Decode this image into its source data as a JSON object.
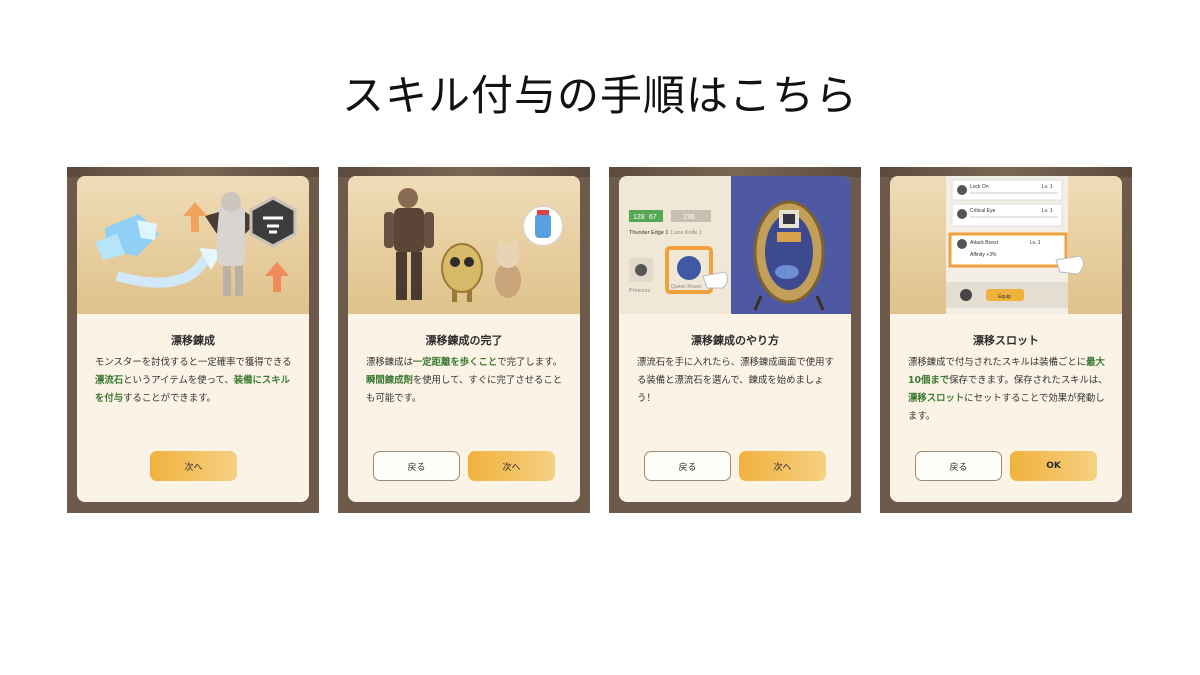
{
  "page_title": "スキル付与の手順はこちら",
  "cards": [
    {
      "title": "漂移錬成",
      "body": [
        {
          "text": "モンスターを討伐すると一定確率で獲得で"
        },
        {
          "text": "きる"
        },
        {
          "text": "漂流石",
          "hl": true
        },
        {
          "text": "というアイテムを使って、"
        },
        {
          "text": "装備",
          "hl": true
        },
        {
          "text": "にスキルを付与",
          "hl": true
        },
        {
          "text": "することができます。"
        }
      ],
      "buttons": {
        "next": "次へ"
      }
    },
    {
      "title": "漂移錬成の完了",
      "body": [
        {
          "text": "漂移錬成は"
        },
        {
          "text": "一定距離を歩くこと",
          "hl": true
        },
        {
          "text": "で完了しま"
        },
        {
          "text": "す。"
        },
        {
          "text": "瞬間錬成剤",
          "hl": true
        },
        {
          "text": "を使用して、すぐに完了さ"
        },
        {
          "text": "せることも可能です。"
        }
      ],
      "buttons": {
        "back": "戻る",
        "next": "次へ"
      }
    },
    {
      "title": "漂移錬成のやり方",
      "body": [
        {
          "text": "漂流石を手に入れたら、漂移錬成画面で使"
        },
        {
          "text": "用する装備と漂流石を選んで、錬成を始め"
        },
        {
          "text": "ましょう！"
        }
      ],
      "buttons": {
        "back": "戻る",
        "next": "次へ"
      },
      "screen_labels": {
        "stat_a": "128",
        "stat_b": "67",
        "stat_c": "236",
        "item_a": "Thunder Edge 1",
        "item_b": "Luna Knife 1",
        "item_c": "Princess",
        "item_d": "Queen Roses"
      }
    },
    {
      "title": "漂移スロット",
      "body": [
        {
          "text": "漂移錬成で付与されたスキルは装備ごとに"
        },
        {
          "text": "最大10個まで",
          "hl": true
        },
        {
          "text": "保存できます。保存された"
        },
        {
          "text": "スキルは、"
        },
        {
          "text": "漂移スロット",
          "hl": true
        },
        {
          "text": "にセットすること"
        },
        {
          "text": "で効果が発動します。"
        }
      ],
      "buttons": {
        "back": "戻る",
        "ok": "OK"
      },
      "screen_labels": {
        "skill_1": "Lock On",
        "skill_2": "Critical Eye",
        "skill_3": "Attack Boost",
        "level": "Lv. 1",
        "sub": "Affinity +3%",
        "save": "Equip"
      }
    }
  ],
  "colors": {
    "accent": "#f0b23c",
    "highlight": "#3b7a32",
    "frame": "#6d5a4a",
    "card_bg": "#fbf3e6"
  }
}
